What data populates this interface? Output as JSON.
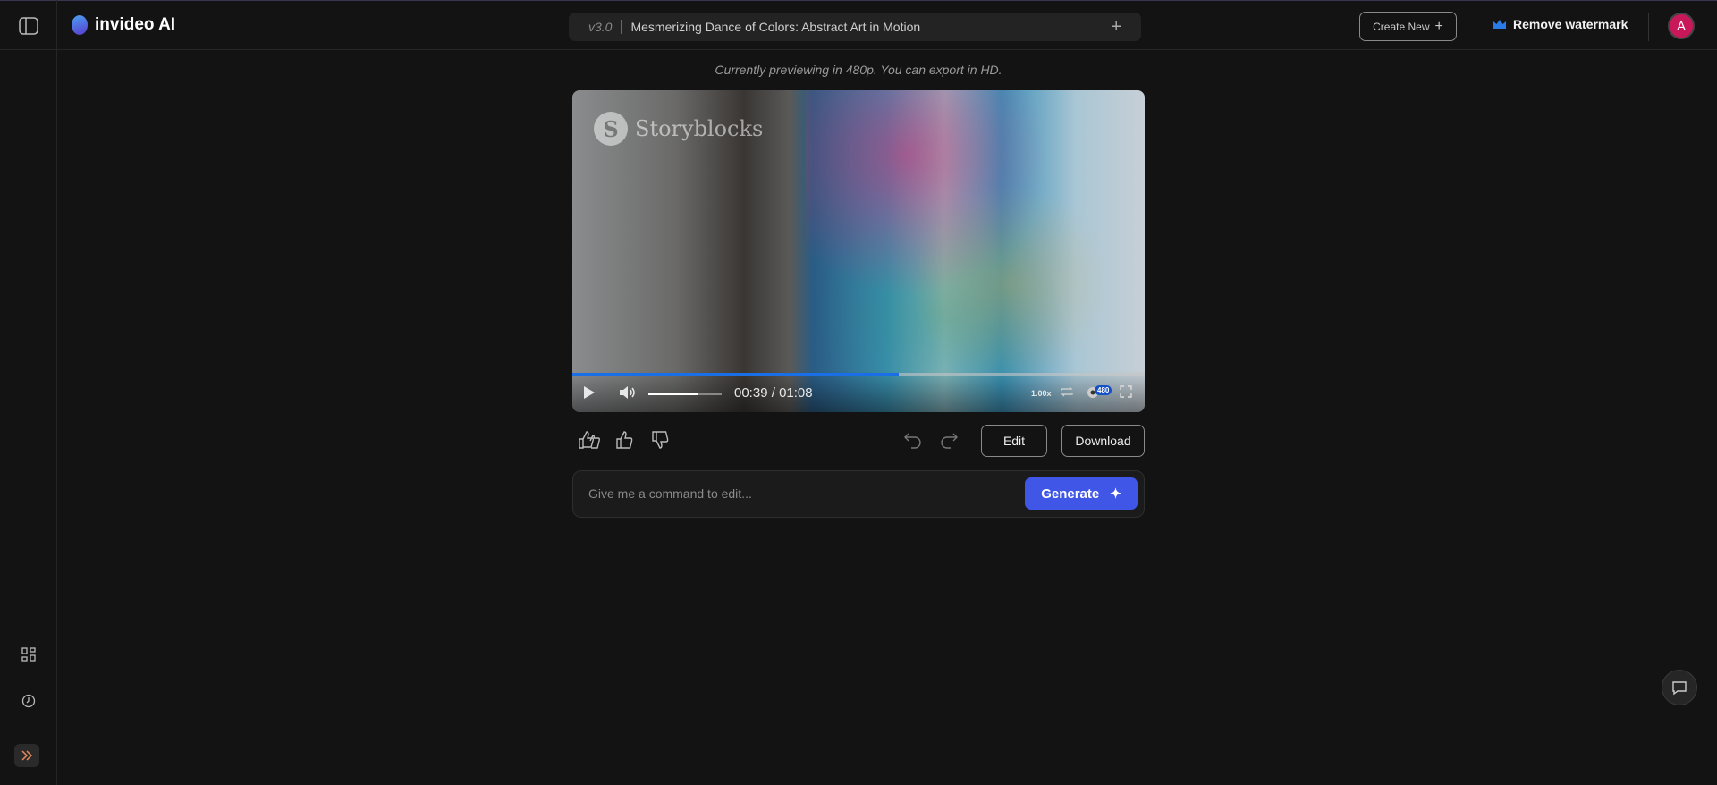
{
  "app": {
    "name": "invideo AI"
  },
  "project": {
    "version": "v3.0",
    "title": "Mesmerizing Dance of Colors: Abstract Art in Motion"
  },
  "header": {
    "create_new": "Create New",
    "remove_watermark": "Remove watermark",
    "avatar_initial": "A"
  },
  "preview_note": "Currently previewing in 480p. You can export in HD.",
  "player": {
    "watermark": "Storyblocks",
    "current_time": "00:39",
    "separator": "/",
    "duration": "01:08",
    "progress": 0.57,
    "volume": 0.67,
    "speed": "1.00x",
    "quality": "480"
  },
  "actions": {
    "edit": "Edit",
    "download": "Download"
  },
  "command": {
    "placeholder": "Give me a command to edit...",
    "generate": "Generate"
  },
  "colors": {
    "accent": "#3f56e6",
    "progress": "#1a6ee6",
    "avatar": "#c8185a"
  }
}
